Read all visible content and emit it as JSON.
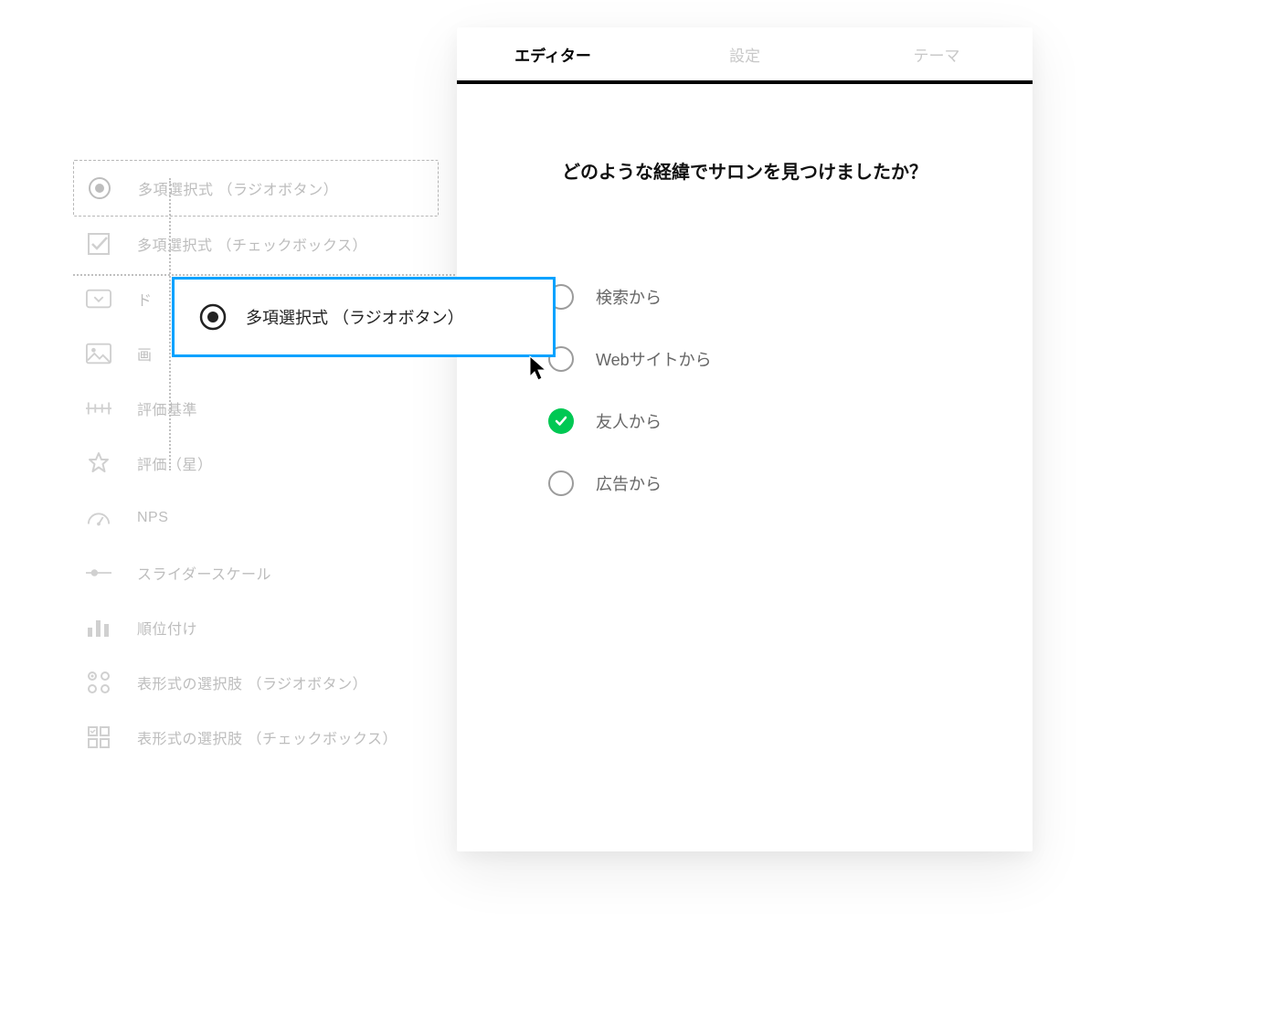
{
  "sidebar": {
    "items": [
      {
        "label": "多項選択式 （ラジオボタン）",
        "icon": "radio-icon",
        "selected": true
      },
      {
        "label": "多項選択式 （チェックボックス）",
        "icon": "checkbox-icon",
        "selected": false
      },
      {
        "label": "ド",
        "icon": "dropdown-icon",
        "selected": false
      },
      {
        "label": "画",
        "icon": "image-icon",
        "selected": false
      },
      {
        "label": "評価基準",
        "icon": "scale-icon",
        "selected": false
      },
      {
        "label": "評価（星）",
        "icon": "star-icon",
        "selected": false
      },
      {
        "label": "NPS",
        "icon": "gauge-icon",
        "selected": false
      },
      {
        "label": "スライダースケール",
        "icon": "slider-icon",
        "selected": false
      },
      {
        "label": "順位付け",
        "icon": "ranking-icon",
        "selected": false
      },
      {
        "label": "表形式の選択肢 （ラジオボタン）",
        "icon": "matrix-radio-icon",
        "selected": false
      },
      {
        "label": "表形式の選択肢 （チェックボックス）",
        "icon": "matrix-checkbox-icon",
        "selected": false
      }
    ]
  },
  "drag": {
    "label": "多項選択式 （ラジオボタン）"
  },
  "preview": {
    "tabs": [
      {
        "label": "エディター",
        "active": true
      },
      {
        "label": "設定",
        "active": false
      },
      {
        "label": "テーマ",
        "active": false
      }
    ],
    "question": "どのような経緯でサロンを見つけましたか？",
    "options": [
      {
        "label": "検索から",
        "checked": false
      },
      {
        "label": "Webサイトから",
        "checked": false
      },
      {
        "label": "友人から",
        "checked": true
      },
      {
        "label": "広告から",
        "checked": false
      }
    ]
  }
}
